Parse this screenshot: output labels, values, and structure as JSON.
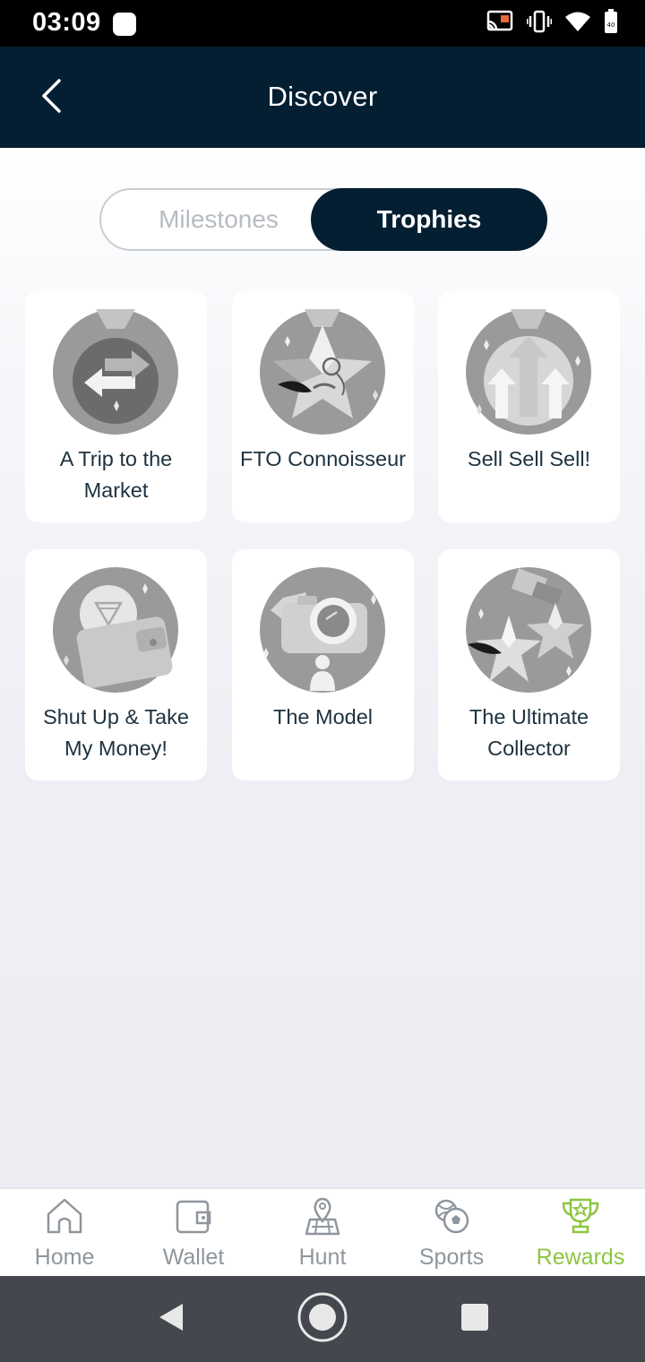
{
  "status_bar": {
    "time": "03:09",
    "icons": [
      "cast-icon",
      "vibrate-icon",
      "wifi-icon",
      "battery-icon"
    ]
  },
  "app_bar": {
    "title": "Discover",
    "back_icon": "chevron-left-icon"
  },
  "segmented_control": {
    "options": [
      {
        "label": "Milestones",
        "selected": false
      },
      {
        "label": "Trophies",
        "selected": true
      }
    ]
  },
  "trophies": [
    {
      "title": "A Trip to the Market",
      "icon": "arrows-medal-icon"
    },
    {
      "title": "FTO Connoisseur",
      "icon": "mustache-star-medal-icon"
    },
    {
      "title": "Sell Sell Sell!",
      "icon": "up-arrows-medal-icon"
    },
    {
      "title": "Shut Up & Take My Money!",
      "icon": "wallet-medal-icon"
    },
    {
      "title": "The Model",
      "icon": "camera-medal-icon"
    },
    {
      "title": "The Ultimate Collector",
      "icon": "stars-medal-icon"
    }
  ],
  "bottom_nav": {
    "items": [
      {
        "label": "Home",
        "icon": "home-icon",
        "active": false
      },
      {
        "label": "Wallet",
        "icon": "wallet-icon",
        "active": false
      },
      {
        "label": "Hunt",
        "icon": "map-pin-icon",
        "active": false
      },
      {
        "label": "Sports",
        "icon": "sports-ball-icon",
        "active": false
      },
      {
        "label": "Rewards",
        "icon": "trophy-icon",
        "active": true
      }
    ]
  },
  "colors": {
    "header_bg": "#041e32",
    "accent_green": "#8cc63f",
    "inactive_gray": "#8f969c",
    "text_dark": "#1d3240"
  }
}
